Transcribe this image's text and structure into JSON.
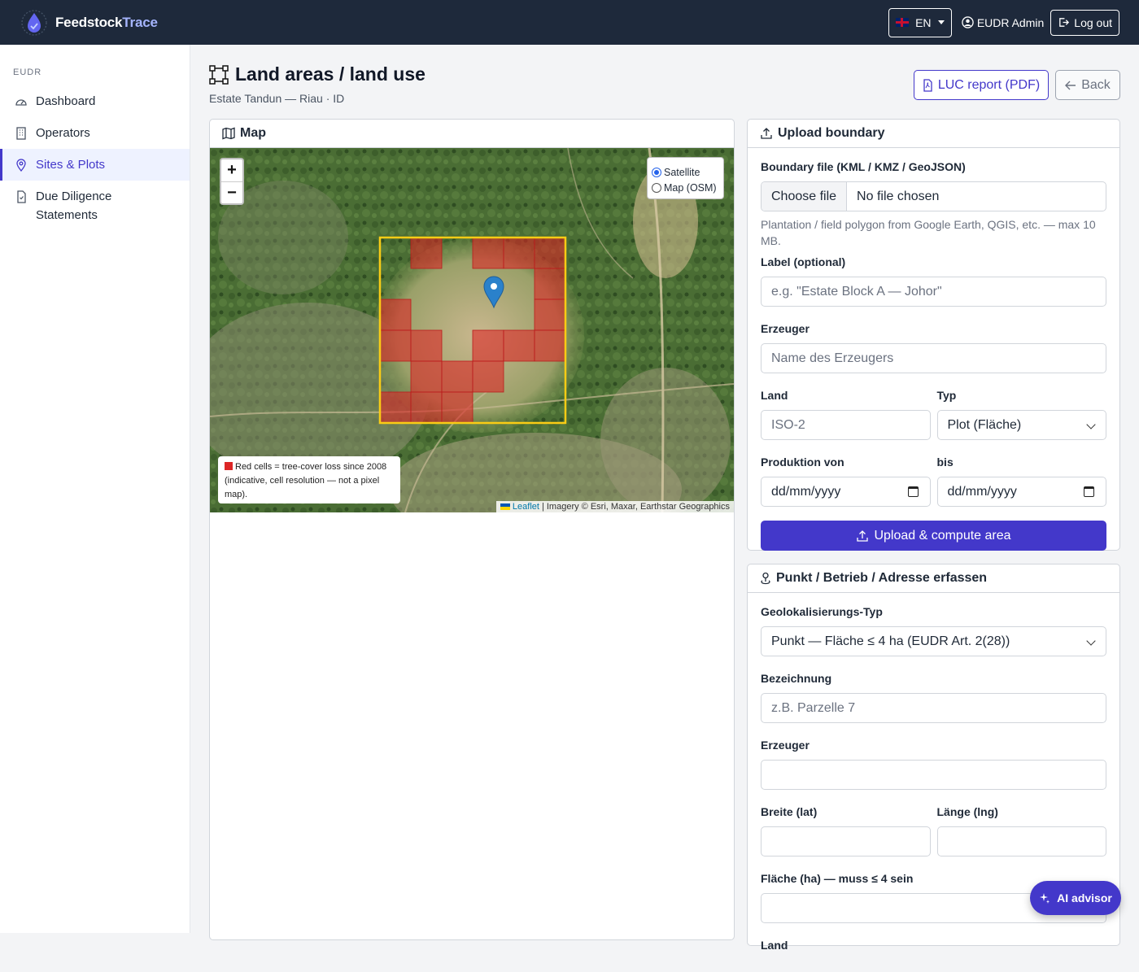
{
  "topbar": {
    "brand_part1": "Feedstock",
    "brand_part2": "Trace",
    "language": "EN",
    "user_name": "EUDR Admin",
    "logout_label": "Log out"
  },
  "sidebar": {
    "section_label": "EUDR",
    "items": [
      {
        "label": "Dashboard",
        "icon": "dashboard-gauge-icon"
      },
      {
        "label": "Operators",
        "icon": "building-icon"
      },
      {
        "label": "Sites & Plots",
        "icon": "map-pin-icon",
        "active": true
      },
      {
        "label": "Due Diligence Statements",
        "icon": "file-check-icon"
      }
    ]
  },
  "page": {
    "title": "Land areas / land use",
    "subtitle": "Estate Tandun — Riau · ID",
    "luc_report_label": "LUC report (PDF)",
    "back_label": "Back"
  },
  "map": {
    "title": "Map",
    "zoom_in": "+",
    "zoom_out": "−",
    "layers": [
      {
        "label": "Satellite",
        "selected": true
      },
      {
        "label": "Map (OSM)",
        "selected": false
      }
    ],
    "legend_text": "Red cells = tree-cover loss since 2008 (indicative, cell resolution — not a pixel map).",
    "attribution_link": "Leaflet",
    "attribution_text": "| Imagery © Esri, Maxar, Earthstar Geographics",
    "colors": {
      "loss_cell": "#dc2626",
      "boundary": "#facc15",
      "marker": "#2a81cb"
    }
  },
  "upload": {
    "title": "Upload boundary",
    "file_label": "Boundary file (KML / KMZ / GeoJSON)",
    "file_button": "Choose file",
    "file_status": "No file chosen",
    "file_help": "Plantation / field polygon from Google Earth, QGIS, etc. — max 10 MB.",
    "label_label": "Label (optional)",
    "label_placeholder": "e.g. \"Estate Block A — Johor\"",
    "producer_label": "Erzeuger",
    "producer_placeholder": "Name des Erzeugers",
    "country_label": "Land",
    "country_placeholder": "ISO-2",
    "type_label": "Typ",
    "type_value": "Plot (Fläche)",
    "prod_from_label": "Produktion von",
    "prod_from_placeholder": "dd/mm/yyyy",
    "prod_to_label": "bis",
    "prod_to_placeholder": "dd/mm/yyyy",
    "submit_label": "Upload & compute area"
  },
  "point": {
    "title": "Punkt / Betrieb / Adresse erfassen",
    "geo_type_label": "Geolokalisierungs-Typ",
    "geo_type_value": "Punkt — Fläche ≤ 4 ha (EUDR Art. 2(28))",
    "name_label": "Bezeichnung",
    "name_placeholder": "z.B. Parzelle 7",
    "producer_label": "Erzeuger",
    "lat_label": "Breite (lat)",
    "lng_label": "Länge (lng)",
    "area_label": "Fläche (ha) — muss ≤ 4 sein",
    "country_label": "Land"
  },
  "ai_advisor_label": "AI advisor"
}
